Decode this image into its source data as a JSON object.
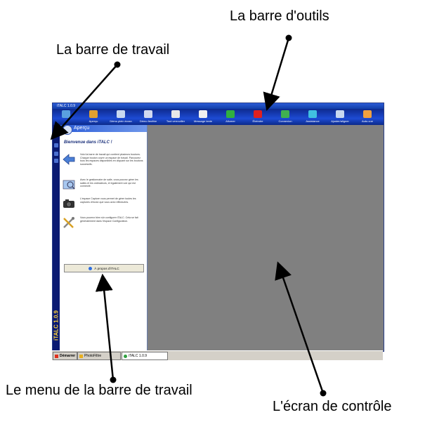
{
  "callouts": {
    "toolbar": "La barre d'outils",
    "taskbar": "La barre de travail",
    "menu": "Le menu de la barre de travail",
    "screen": "L'écran de contrôle"
  },
  "window": {
    "title": "iTALC 1.0.9"
  },
  "toolbar": {
    "buttons": [
      {
        "label": "",
        "icon": "screens-icon",
        "color": "#5aa0e0"
      },
      {
        "label": "Aperçu",
        "icon": "overview-icon",
        "color": "#e0a030"
      },
      {
        "label": "Démo plein écran",
        "icon": "fullscreen-demo-icon",
        "color": "#c8d8f0"
      },
      {
        "label": "Démo fenêtre",
        "icon": "window-demo-icon",
        "color": "#d0d8f0"
      },
      {
        "label": "Tout verrouiller",
        "icon": "lock-icon",
        "color": "#e8e8e8"
      },
      {
        "label": "Message texte",
        "icon": "message-icon",
        "color": "#f0f0f0"
      },
      {
        "label": "Allumer",
        "icon": "power-on-icon",
        "color": "#30b040"
      },
      {
        "label": "Éteindre",
        "icon": "power-off-icon",
        "color": "#e02020"
      },
      {
        "label": "Connexion",
        "icon": "login-icon",
        "color": "#40b050"
      },
      {
        "label": "Assistance",
        "icon": "support-icon",
        "color": "#40c0e0"
      },
      {
        "label": "Ajuster/aligner",
        "icon": "align-icon",
        "color": "#c8d8f0"
      },
      {
        "label": "Auto-vue",
        "icon": "auto-view-icon",
        "color": "#f0a040"
      }
    ]
  },
  "sidebar": {
    "logo": "iTALC 1.0.9"
  },
  "panel": {
    "title": "Aperçu",
    "welcome": "Bienvenue dans iTALC !",
    "items": [
      {
        "icon": "arrow-left-icon",
        "text": "Voici la barre de travail qui contient plusieurs boutons. Chaque bouton ouvre un espace de travail. Parcourez tous les espaces disponibles en cliquant sur les boutons successifs."
      },
      {
        "icon": "classroom-icon",
        "text": "Avec le gestionnaire de salle, vous pouvez gérer les salles et les ordinateurs, et également voir qui est connecté."
      },
      {
        "icon": "camera-icon",
        "text": "L'espace Capture vous permet de gérer toutes les captures d'écran que vous avez effectuées."
      },
      {
        "icon": "tools-icon",
        "text": "Vous pourrez bien sûr configurer iTALC. Cela se fait généralement dans l'espace Configuration."
      }
    ],
    "about_button": "À propos d'iTALC"
  },
  "taskbar": {
    "start": "Démarrer",
    "tasks": [
      "PhotoFiltre",
      "iTALC 1.0.9"
    ]
  }
}
